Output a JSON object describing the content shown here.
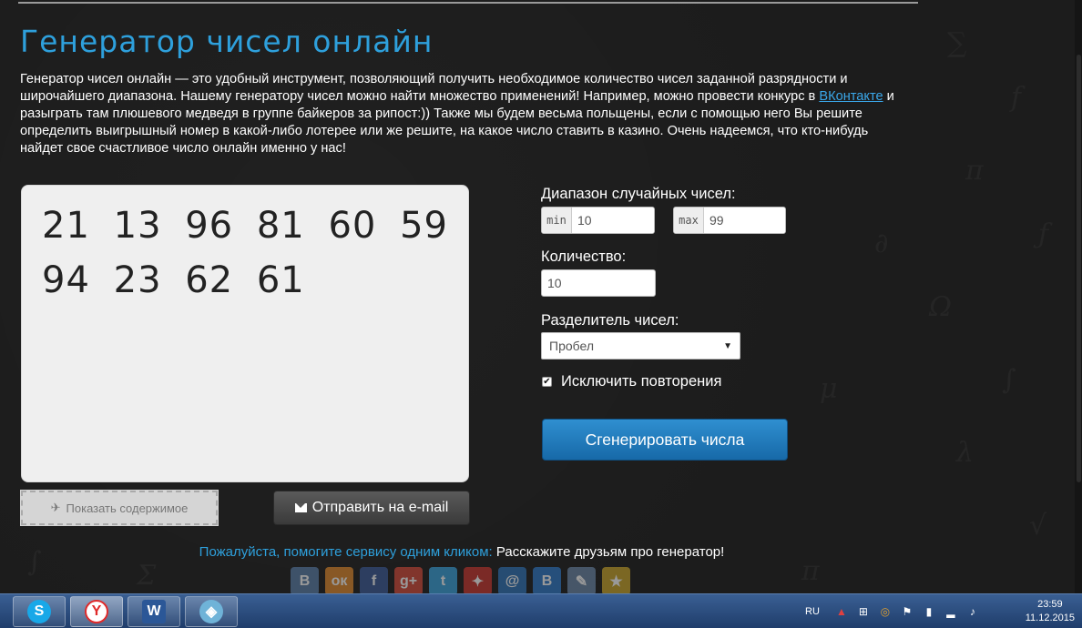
{
  "page": {
    "title": "Генератор чисел онлайн",
    "intro_parts": [
      "Генератор чисел онлайн — это удобный инструмент, позволяющий получить необходимое количество чисел заданной разрядности и широчайшего диапазона. Нашему генератору чисел можно найти множество применений! Например, можно провести конкурс в ",
      "ВКонтакте",
      " и разыграть там плюшевого медведя в группе байкеров за рипост:)) Также мы будем весьма польщены, если с помощью него Вы решите определить выигрышный номер в какой-либо лотерее или же решите, на какое число ставить в казино. Очень надеемся, что кто-нибудь найдет свое счастливое число онлайн именно у нас!"
    ]
  },
  "result": {
    "numbers": "21 13 96 81 60 59 94 23 62 61"
  },
  "buttons": {
    "show_content": "Показать содержимое",
    "send_email": "Отправить на e-mail",
    "generate": "Сгенерировать числа"
  },
  "form": {
    "range_label": "Диапазон случайных чисел:",
    "min_addon": "min",
    "min_value": "10",
    "max_addon": "max",
    "max_value": "99",
    "count_label": "Количество:",
    "count_value": "10",
    "separator_label": "Разделитель чисел:",
    "separator_value": "Пробел",
    "exclude_label": "Исключить повторения",
    "exclude_checked": true
  },
  "help": {
    "blue_text": "Пожалуйста, помогите сервису одним кликом:",
    "white_text": "Расскажите друзьям про генератор!"
  },
  "share": [
    {
      "icon": "vk-icon",
      "glyph": "B",
      "color": "#5a7fa8"
    },
    {
      "icon": "odnoklassniki-icon",
      "glyph": "ок",
      "color": "#e0892c"
    },
    {
      "icon": "facebook-icon",
      "glyph": "f",
      "color": "#3b5a98"
    },
    {
      "icon": "google-plus-icon",
      "glyph": "g+",
      "color": "#d44a3a"
    },
    {
      "icon": "twitter-icon",
      "glyph": "t",
      "color": "#3aa3dd"
    },
    {
      "icon": "moimir-icon",
      "glyph": "✦",
      "color": "#c8362f"
    },
    {
      "icon": "mail-icon",
      "glyph": "@",
      "color": "#2f74b8"
    },
    {
      "icon": "blogger-icon",
      "glyph": "B",
      "color": "#2f79c8"
    },
    {
      "icon": "livejournal-icon",
      "glyph": "✎",
      "color": "#6a86a6"
    },
    {
      "icon": "favorites-icon",
      "glyph": "★",
      "color": "#c9a52a"
    }
  ],
  "taskbar": {
    "lang": "RU",
    "time": "23:59",
    "date": "11.12.2015"
  }
}
